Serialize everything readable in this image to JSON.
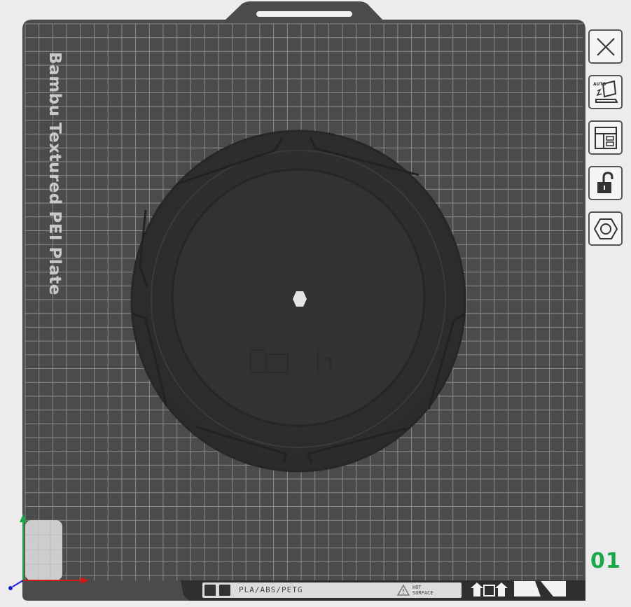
{
  "plate": {
    "name_label": "Bambu Textured PEI Plate",
    "number": "01",
    "materials": "PLA/ABS/PETG",
    "warning_line1": "HOT",
    "warning_line2": "SURFACE"
  },
  "sidebar": {
    "buttons": [
      {
        "name": "close-button",
        "icon": "close-icon"
      },
      {
        "name": "auto-orient-button",
        "icon": "auto-orient-icon"
      },
      {
        "name": "arrange-button",
        "icon": "layout-icon"
      },
      {
        "name": "lock-button",
        "icon": "unlock-icon"
      },
      {
        "name": "plate-settings-button",
        "icon": "hexagon-nut-icon"
      }
    ]
  },
  "colors": {
    "plate": "#4a4b4b",
    "grid": "#8a8b8b",
    "model": "#2f3031",
    "plate_number": "#19a84a",
    "axis_x": "#d21a1a",
    "axis_y": "#19a84a",
    "axis_z": "#1a1ad2"
  }
}
